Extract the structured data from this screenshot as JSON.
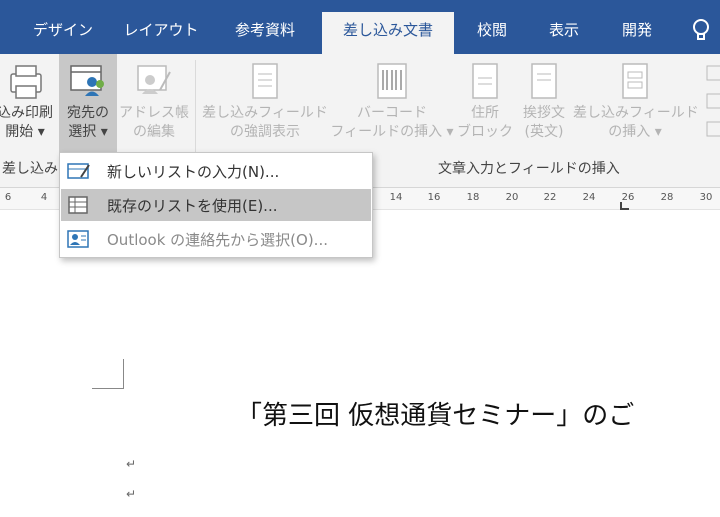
{
  "tabs": [
    {
      "label": "デザイン",
      "active": false
    },
    {
      "label": "レイアウト",
      "active": false
    },
    {
      "label": "参考資料",
      "active": false
    },
    {
      "label": "差し込み文書",
      "active": true
    },
    {
      "label": "校閲",
      "active": false
    },
    {
      "label": "表示",
      "active": false
    },
    {
      "label": "開発",
      "active": false
    }
  ],
  "ribbon": {
    "start_merge": {
      "line1": "込み印刷",
      "line2": "開始 ▾"
    },
    "select_recipients": {
      "line1": "宛先の",
      "line2": "選択 ▾"
    },
    "edit_address_book": {
      "line1": "アドレス帳",
      "line2": "の編集"
    },
    "highlight_fields": {
      "line1": "差し込みフィールド",
      "line2": "の強調表示"
    },
    "barcode_field": {
      "line1": "バーコード",
      "line2": "フィールドの挿入 ▾"
    },
    "address_block": {
      "line1": "住所",
      "line2": "ブロック"
    },
    "greeting_line": {
      "line1": "挨拶文",
      "line2": "(英文)"
    },
    "insert_merge_field": {
      "line1": "差し込みフィールド",
      "line2": "の挿入 ▾"
    },
    "group_start": "差し込み",
    "group_write_insert": "文章入力とフィールドの挿入"
  },
  "ruler": [
    "6",
    "4",
    "14",
    "16",
    "18",
    "20",
    "22",
    "24",
    "26",
    "28",
    "30"
  ],
  "dropdown": {
    "items": [
      {
        "label": "新しいリストの入力(N)...",
        "highlighted": false,
        "dim": false
      },
      {
        "label": "既存のリストを使用(E)...",
        "highlighted": true,
        "dim": false
      },
      {
        "label": "Outlook の連絡先から選択(O)...",
        "highlighted": false,
        "dim": true
      }
    ]
  },
  "document": {
    "heading": "「第三回 仮想通貨セミナー」のご",
    "paragraph_mark": "↵"
  },
  "colors": {
    "accent": "#2b579a",
    "ribbon_bg": "#f3f3f3",
    "highlight": "#c6c6c6"
  }
}
